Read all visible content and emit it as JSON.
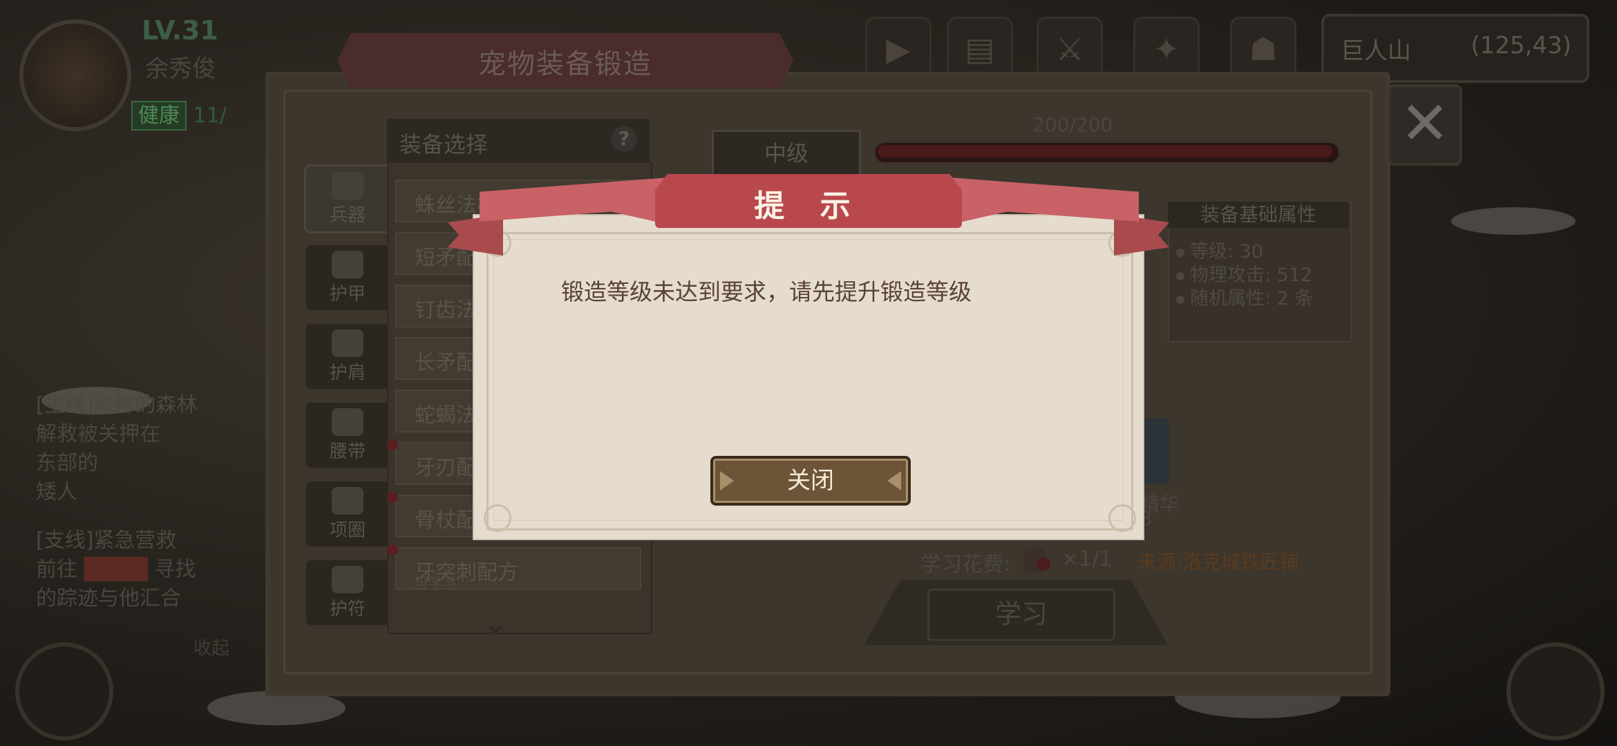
{
  "player": {
    "level": "LV.31",
    "name": "余秀俊",
    "status_tag": "健康",
    "status_value": "11/"
  },
  "quests": {
    "main_title": "[主线]恐怖的森林",
    "main_desc_1": "解救被关押在",
    "main_desc_2": "东部的",
    "main_desc_3": "矮人",
    "side_title": "[支线]紧急营救",
    "side_desc_1": "前往",
    "side_desc_1b": "寻找",
    "side_desc_2": "的踪迹与他汇合",
    "collapse": "收起"
  },
  "location": {
    "name": "巨人山",
    "coords": "(125,43)"
  },
  "forge_panel": {
    "title": "宠物装备锻造",
    "tabs": [
      "兵器",
      "护甲",
      "护肩",
      "腰带",
      "项圈",
      "护符"
    ],
    "list_header": "装备选择",
    "help_label": "?",
    "items": [
      {
        "label": "蛛丝法杖配方",
        "sub": ""
      },
      {
        "label": "短矛配方",
        "sub": ""
      },
      {
        "label": "钉齿法杖配方",
        "sub": ""
      },
      {
        "label": "长矛配方",
        "sub": ""
      },
      {
        "label": "蛇蝎法杖配方",
        "sub": ""
      },
      {
        "label": "牙刃配方",
        "sub": ""
      },
      {
        "label": "骨杖配方",
        "sub": ""
      },
      {
        "label": "牙突刺配方",
        "sub": "可学习"
      }
    ],
    "forge_level": "中级",
    "progress_text": "200/200",
    "progress": 1.0,
    "attr_header": "装备基础属性",
    "attributes": [
      "等级: 30",
      "物理攻击: 512",
      "随机属性: 2 条"
    ],
    "material_name": "精华",
    "material_count": "3",
    "cost_label": "学习花费:",
    "cost_qty": "×1/1",
    "source": "来源:洛克城铁匠铺",
    "learn_button": "学习",
    "close_icon": "close-icon"
  },
  "dialog": {
    "title": "提 示",
    "message": "锻造等级未达到要求，请先提升锻造等级",
    "button": "关闭"
  },
  "colors": {
    "ribbon": "#c86266",
    "dialog_bg": "#e5dccd",
    "button_bg": "#6d5438",
    "message": "#5a4334"
  }
}
